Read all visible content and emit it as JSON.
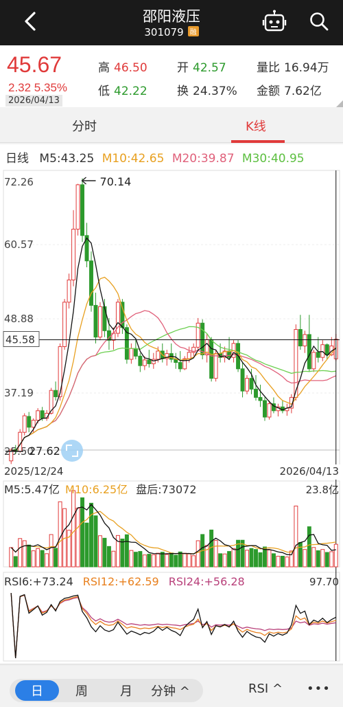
{
  "header": {
    "title": "邵阳液压",
    "code": "301079",
    "margin_tag": "融"
  },
  "quote": {
    "price": "45.67",
    "change": "2.32 5.35%",
    "date": "2026/04/13",
    "high_label": "高",
    "high": "46.50",
    "open_label": "开",
    "open": "42.57",
    "volume_ratio_label": "量比",
    "volume_ratio": "16.94万",
    "low_label": "低",
    "low": "42.22",
    "turnover_label": "换",
    "turnover": "24.37%",
    "amount_label": "金额",
    "amount": "7.62亿"
  },
  "tabs": {
    "intraday": "分时",
    "kline": "K线"
  },
  "kline": {
    "period": "日线",
    "ma5": "M5:43.25",
    "ma10": "M10:42.65",
    "ma20": "M20:39.87",
    "ma30": "M30:40.95",
    "price_labels": [
      "72.26",
      "60.57",
      "48.88",
      "45.58",
      "37.19",
      "25.50"
    ],
    "max_marker": "70.14",
    "min_marker": "27.62",
    "date_start": "2025/12/24",
    "date_end": "2026/04/13"
  },
  "volume": {
    "ma5": "M5:5.47亿",
    "ma10": "M10:6.25亿",
    "after_hours": "盘后:73072",
    "max": "23.8亿"
  },
  "rsi": {
    "rsi6": "RSI6:+73.24",
    "rsi12": "RSI12:+62.59",
    "rsi24": "RSI24:+56.28",
    "max": "97.70"
  },
  "bottom_bar": {
    "day": "日",
    "week": "周",
    "month": "月",
    "minute": "分钟 ^",
    "indicator": "RSI ^",
    "more": "•••"
  },
  "colors": {
    "up": "#e03a3a",
    "down": "#2c9a2c",
    "ma5": "#111111",
    "ma10": "#e8a020",
    "ma20": "#e0607a",
    "ma30": "#6ccf50",
    "accent": "#2b7fe6"
  },
  "chart_data": {
    "type": "candlestick",
    "x_range": [
      "2025/12/24",
      "2026/04/13"
    ],
    "ylim": [
      25.5,
      72.26
    ],
    "candles": [
      [
        26.5,
        28.5,
        26.0,
        28.2
      ],
      [
        28.3,
        29.0,
        27.6,
        28.0
      ],
      [
        28.0,
        31.5,
        27.8,
        31.0
      ],
      [
        31.0,
        34.0,
        30.5,
        33.6
      ],
      [
        33.5,
        34.2,
        31.0,
        31.8
      ],
      [
        31.8,
        33.2,
        31.0,
        32.9
      ],
      [
        32.9,
        34.8,
        32.4,
        34.4
      ],
      [
        34.4,
        35.0,
        32.8,
        33.2
      ],
      [
        33.2,
        34.5,
        32.8,
        34.0
      ],
      [
        34.0,
        38.0,
        33.8,
        37.6
      ],
      [
        37.6,
        39.0,
        36.0,
        36.6
      ],
      [
        36.6,
        45.0,
        36.0,
        44.5
      ],
      [
        44.5,
        52.0,
        44.0,
        51.5
      ],
      [
        51.5,
        56.0,
        50.5,
        55.0
      ],
      [
        55.0,
        66.0,
        54.0,
        63.0
      ],
      [
        63.0,
        70.14,
        62.0,
        70.0
      ],
      [
        70.0,
        71.0,
        61.0,
        62.0
      ],
      [
        62.0,
        64.0,
        57.0,
        58.0
      ],
      [
        58.0,
        59.5,
        50.0,
        51.0
      ],
      [
        51.0,
        53.0,
        45.0,
        46.0
      ],
      [
        46.0,
        51.5,
        45.5,
        50.8
      ],
      [
        50.8,
        52.0,
        46.0,
        47.0
      ],
      [
        47.0,
        49.0,
        44.0,
        45.5
      ],
      [
        45.5,
        47.5,
        44.0,
        46.6
      ],
      [
        46.6,
        52.0,
        46.0,
        51.5
      ],
      [
        51.5,
        52.0,
        46.5,
        47.5
      ],
      [
        47.5,
        48.0,
        41.8,
        42.5
      ],
      [
        42.5,
        45.0,
        41.8,
        44.2
      ],
      [
        44.2,
        45.5,
        42.5,
        43.0
      ],
      [
        43.0,
        43.5,
        40.5,
        41.5
      ],
      [
        41.5,
        43.0,
        40.8,
        42.4
      ],
      [
        42.4,
        44.0,
        41.2,
        41.8
      ],
      [
        41.8,
        43.5,
        41.0,
        42.5
      ],
      [
        42.5,
        44.5,
        42.0,
        43.8
      ],
      [
        43.8,
        45.0,
        42.0,
        42.6
      ],
      [
        42.6,
        44.0,
        41.5,
        43.4
      ],
      [
        43.4,
        45.0,
        42.0,
        42.5
      ],
      [
        42.5,
        43.5,
        41.0,
        42.0
      ],
      [
        42.0,
        43.8,
        40.5,
        41.0
      ],
      [
        41.0,
        43.0,
        40.8,
        42.6
      ],
      [
        42.6,
        44.5,
        42.0,
        43.6
      ],
      [
        43.6,
        45.0,
        43.0,
        44.4
      ],
      [
        44.4,
        49.0,
        44.0,
        48.2
      ],
      [
        48.2,
        48.8,
        42.5,
        43.2
      ],
      [
        43.2,
        46.5,
        42.0,
        45.6
      ],
      [
        45.6,
        46.0,
        39.0,
        39.5
      ],
      [
        39.5,
        44.0,
        39.0,
        43.4
      ],
      [
        43.4,
        45.0,
        42.0,
        42.8
      ],
      [
        42.8,
        44.5,
        42.0,
        43.8
      ],
      [
        43.8,
        46.0,
        42.5,
        42.8
      ],
      [
        42.8,
        45.5,
        42.0,
        45.0
      ],
      [
        45.0,
        45.5,
        40.5,
        41.0
      ],
      [
        41.0,
        42.0,
        36.5,
        37.5
      ],
      [
        37.5,
        40.0,
        37.0,
        39.5
      ],
      [
        39.5,
        41.0,
        37.0,
        37.8
      ],
      [
        37.8,
        40.0,
        36.0,
        36.5
      ],
      [
        36.5,
        38.5,
        35.0,
        36.0
      ],
      [
        36.0,
        36.5,
        32.8,
        33.4
      ],
      [
        33.4,
        36.0,
        33.0,
        35.5
      ],
      [
        35.5,
        36.5,
        34.0,
        34.4
      ],
      [
        34.4,
        35.5,
        33.5,
        35.0
      ],
      [
        35.0,
        36.0,
        34.0,
        34.4
      ],
      [
        34.4,
        35.5,
        33.6,
        34.8
      ],
      [
        34.8,
        37.0,
        34.0,
        36.5
      ],
      [
        36.5,
        48.0,
        36.0,
        47.2
      ],
      [
        47.2,
        49.5,
        44.0,
        44.6
      ],
      [
        44.6,
        47.0,
        43.5,
        46.4
      ],
      [
        46.4,
        49.5,
        40.5,
        41.0
      ],
      [
        41.0,
        44.0,
        40.5,
        43.6
      ],
      [
        43.6,
        46.0,
        42.0,
        42.8
      ],
      [
        42.8,
        45.5,
        42.2,
        44.8
      ],
      [
        44.8,
        45.0,
        42.5,
        43.2
      ],
      [
        43.2,
        46.0,
        43.0,
        44.6
      ],
      [
        42.57,
        46.5,
        42.22,
        45.67
      ]
    ]
  }
}
